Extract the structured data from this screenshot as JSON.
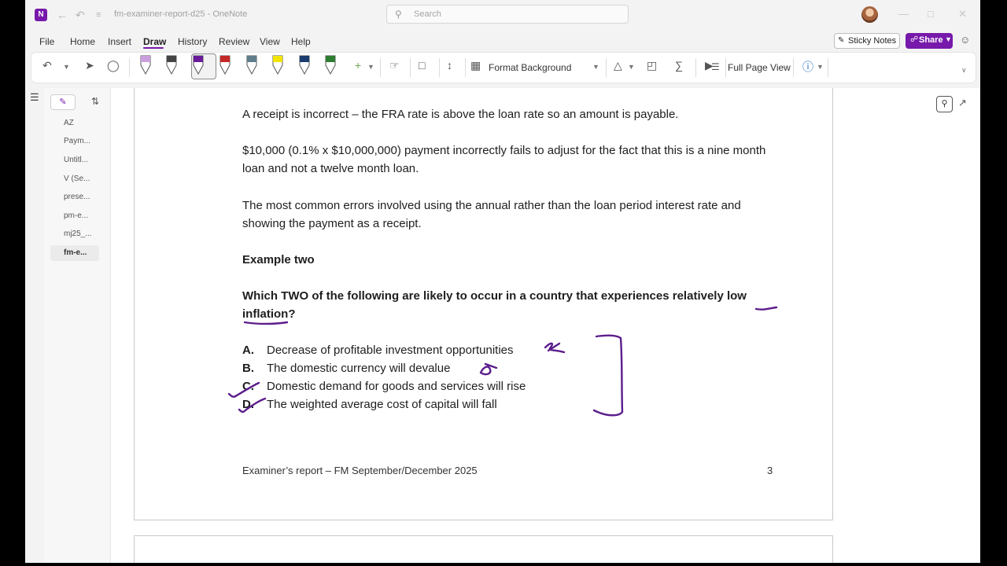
{
  "titlebar": {
    "doc_title": "fm-examiner-report-d25 - OneNote",
    "search_placeholder": "Search",
    "logo_letter": "N"
  },
  "menu": {
    "items": [
      "File",
      "Home",
      "Insert",
      "Draw",
      "History",
      "Review",
      "View",
      "Help"
    ],
    "active": "Draw",
    "sticky_notes": "Sticky Notes",
    "share": "Share"
  },
  "ribbon": {
    "format_background": "Format Background",
    "full_page_view": "Full Page View",
    "pen_colors": [
      "#c9a0dc",
      "#444444",
      "#6a1b9a",
      "#c62828",
      "#607d8b",
      "#f2e600",
      "#1a3c6e",
      "#2e7d32"
    ],
    "accent": "#7719aa"
  },
  "pages": {
    "items": [
      "AZ",
      "Paym...",
      "Untitl...",
      "V (Se...",
      "prese...",
      "pm-e...",
      "mj25_...",
      "fm-e..."
    ],
    "active_index": 7
  },
  "note": {
    "p1": "A receipt is incorrect – the FRA rate is above the loan rate so an amount is payable.",
    "p2": "$10,000 (0.1% x $10,000,000) payment incorrectly fails to adjust for the fact that this is a nine month loan and not a  twelve month loan.",
    "p3": "The most common errors involved using the annual rather than the loan period interest rate and showing the payment as a receipt.",
    "heading": "Example two",
    "question": "Which TWO of the following are likely to occur in a country that experiences relatively low inflation?",
    "options": [
      {
        "letter": "A.",
        "text": "Decrease of profitable investment opportunities"
      },
      {
        "letter": "B.",
        "text": "The domestic currency will devalue"
      },
      {
        "letter": "C.",
        "text": "Domestic demand for goods and services will rise"
      },
      {
        "letter": "D.",
        "text": "The weighted average cost of capital will fall"
      }
    ],
    "footer": "Examiner’s report – FM September/December 2025",
    "page_number": "3"
  },
  "ink_color": "#5b1d8c"
}
